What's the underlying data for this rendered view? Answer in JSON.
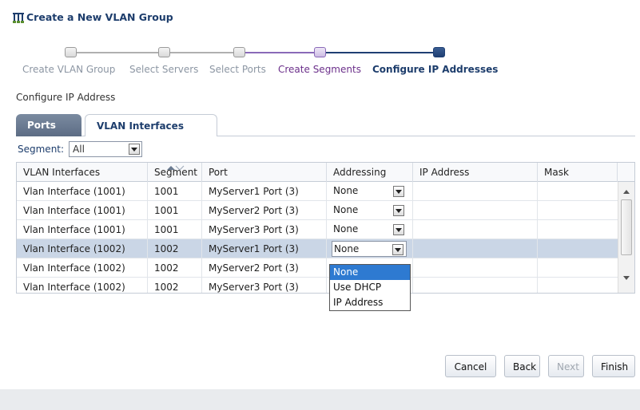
{
  "window": {
    "title": "Create a New VLAN Group",
    "title_icon": "vlan-network-icon"
  },
  "train": {
    "steps": [
      {
        "label": "Create VLAN Group",
        "state": "visited"
      },
      {
        "label": "Select Servers",
        "state": "visited"
      },
      {
        "label": "Select Ports",
        "state": "visited"
      },
      {
        "label": "Create Segments",
        "state": "previous"
      },
      {
        "label": "Configure IP Addresses",
        "state": "current"
      }
    ]
  },
  "section": {
    "label": "Configure IP Address"
  },
  "tabs": [
    {
      "label": "Ports"
    },
    {
      "label": "VLAN Interfaces"
    }
  ],
  "segment": {
    "label": "Segment:",
    "value": "All"
  },
  "table": {
    "columns": [
      "VLAN Interfaces",
      "Segment",
      "Port",
      "Addressing",
      "IP Address",
      "Mask"
    ],
    "rows": [
      {
        "iface": "Vlan Interface (1001)",
        "segment": "1001",
        "port": "MyServer1 Port (3)",
        "addressing": "None",
        "ip": "",
        "mask": ""
      },
      {
        "iface": "Vlan Interface (1001)",
        "segment": "1001",
        "port": "MyServer2 Port (3)",
        "addressing": "None",
        "ip": "",
        "mask": ""
      },
      {
        "iface": "Vlan Interface (1001)",
        "segment": "1001",
        "port": "MyServer3 Port (3)",
        "addressing": "None",
        "ip": "",
        "mask": ""
      },
      {
        "iface": "Vlan Interface (1002)",
        "segment": "1002",
        "port": "MyServer1 Port (3)",
        "addressing": "None",
        "ip": "",
        "mask": ""
      },
      {
        "iface": "Vlan Interface (1002)",
        "segment": "1002",
        "port": "MyServer2 Port (3)",
        "addressing": "",
        "ip": "",
        "mask": ""
      },
      {
        "iface": "Vlan Interface (1002)",
        "segment": "1002",
        "port": "MyServer3 Port (3)",
        "addressing": "",
        "ip": "",
        "mask": ""
      }
    ],
    "selected_row": 3
  },
  "dropdown": {
    "options": [
      "None",
      "Use DHCP",
      "IP Address"
    ],
    "selected": "None"
  },
  "buttons": {
    "cancel": "Cancel",
    "back": "Back",
    "next": "Next",
    "finish": "Finish"
  },
  "colors": {
    "accent": "#1d3d6c",
    "prev_step": "#6b2f8a",
    "selection": "#cad6e6",
    "dropdown_highlight": "#2e7ad1"
  }
}
